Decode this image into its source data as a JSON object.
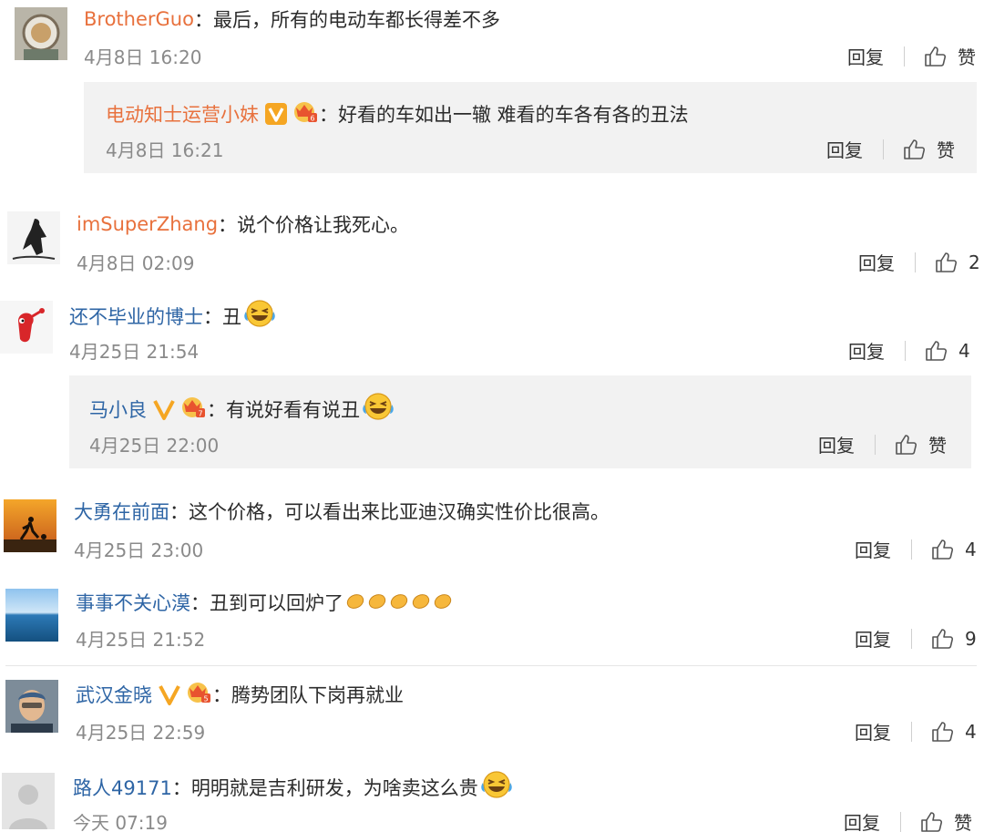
{
  "colors": {
    "username": "#2e65a5",
    "orange_username": "#e8713d",
    "time": "#8a8a8a",
    "subbg": "#f2f2f2",
    "vbadge": "#f5a623"
  },
  "actions": {
    "reply": "回复",
    "like": "赞"
  },
  "comments": [
    {
      "user": "BrotherGuo",
      "text": "最后，所有的电动车都长得差不多",
      "time": "4月8日 16:20",
      "likes": "赞"
    },
    {
      "user": "电动知士运营小妹",
      "text": "好看的车如出一辙 难看的车各有各的丑法",
      "time": "4月8日 16:21",
      "likes": "赞"
    },
    {
      "user": "imSuperZhang",
      "text": "说个价格让我死心。",
      "time": "4月8日 02:09",
      "likes": "2"
    },
    {
      "user": "还不毕业的博士",
      "text": "丑",
      "time": "4月25日 21:54",
      "likes": "4"
    },
    {
      "user": "马小良",
      "text": "有说好看有说丑",
      "time": "4月25日 22:00",
      "likes": "赞"
    },
    {
      "user": "大勇在前面",
      "text": "这个价格，可以看出来比亚迪汉确实性价比很高。",
      "time": "4月25日 23:00",
      "likes": "4"
    },
    {
      "user": "事事不关心漠",
      "text": "丑到可以回炉了",
      "time": "4月25日 21:52",
      "likes": "9"
    },
    {
      "user": "武汉金晓",
      "text": "腾势团队下岗再就业",
      "time": "4月25日 22:59",
      "likes": "4"
    },
    {
      "user": "路人49171",
      "text": "明明就是吉利研发，为啥卖这么贵",
      "time": "今天 07:19",
      "likes": "赞"
    }
  ],
  "colon": "："
}
